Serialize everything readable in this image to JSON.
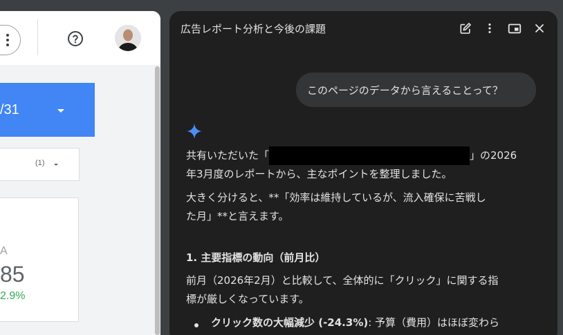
{
  "left_page": {
    "date_text": "/31",
    "filter_count": "(1)",
    "kpi_label": "A",
    "kpi_value": "85",
    "kpi_change": "2.9%"
  },
  "panel": {
    "title": "広告レポート分析と今後の課題",
    "icons": [
      "edit-icon",
      "more-vert-icon",
      "picture-in-picture-icon",
      "close-icon"
    ],
    "user_message": "このページのデータから言えることって？",
    "response": {
      "p1_before": "共有いただいた「",
      "p1_after": "」の2026",
      "p1_line2": "年3月度のレポートから、主なポイントを整理しました。",
      "p2_line1": "大きく分けると、**「効率は維持しているが、流入確保に苦戦し",
      "p2_line2": "た月」**と言えます。",
      "h1": "1. 主要指標の動向（前月比）",
      "p3_line1": "前月（2026年2月）と比較して、全体的に「クリック」に関する指",
      "p3_line2": "標が厳しくなっています。",
      "bullet1_bold": "クリック数の大幅減少 (-24.3%)",
      "bullet1_rest": ": 予算（費用）はほぼ変わら"
    }
  },
  "colors": {
    "panel_bg": "#1f1f1f",
    "date_bar": "#4285f4",
    "positive": "#34a853",
    "sparkle": "#4c8df6"
  }
}
